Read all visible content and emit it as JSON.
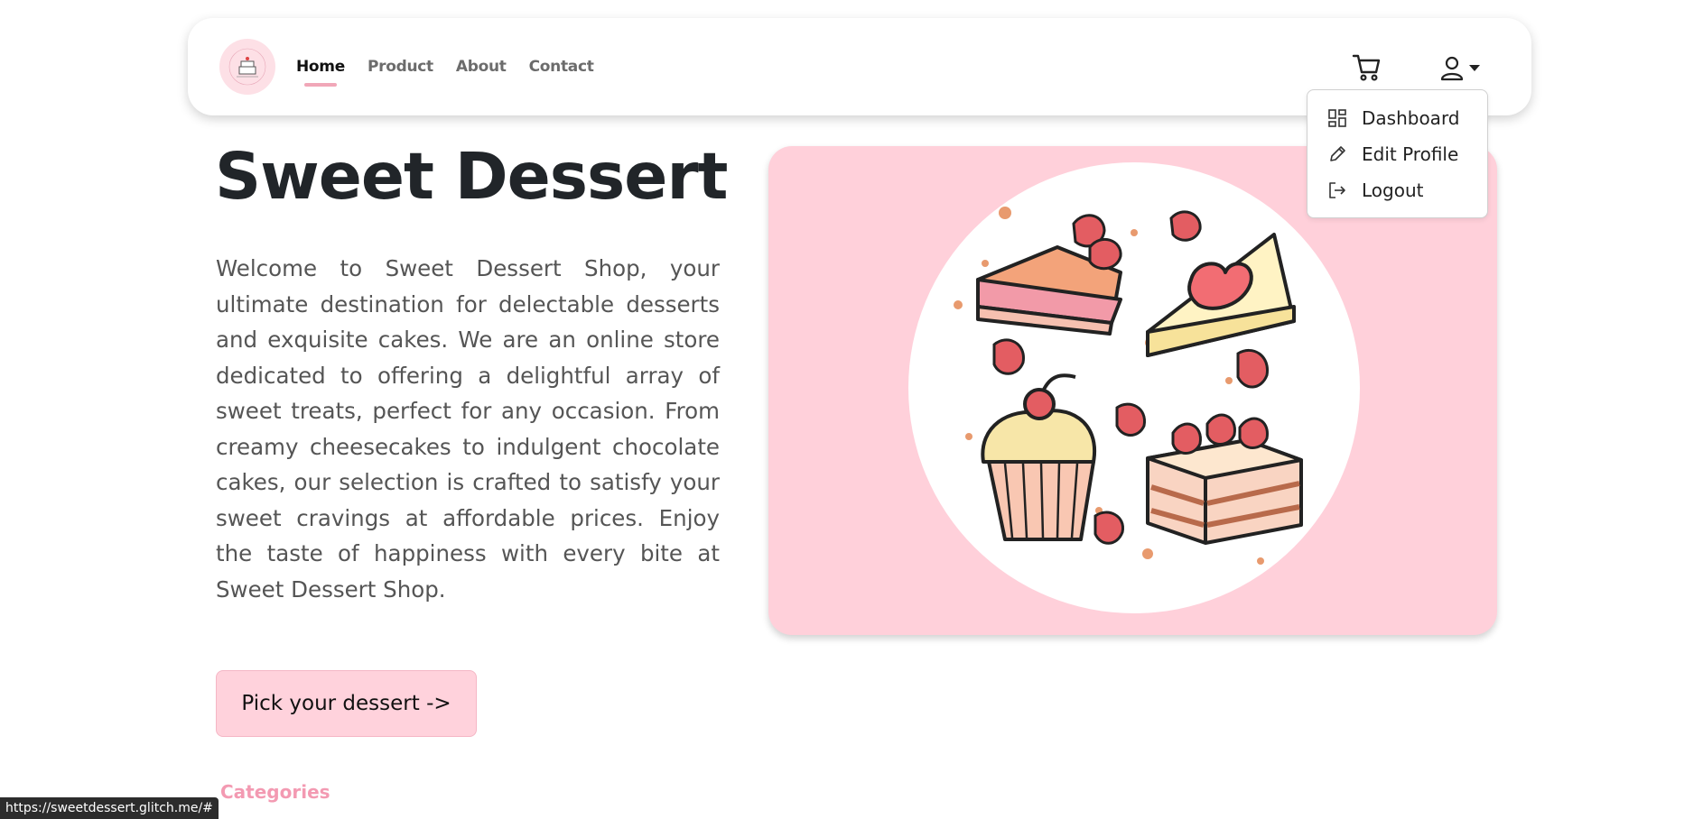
{
  "nav": {
    "links": [
      {
        "label": "Home",
        "active": true
      },
      {
        "label": "Product",
        "active": false
      },
      {
        "label": "About",
        "active": false
      },
      {
        "label": "Contact",
        "active": false
      }
    ]
  },
  "user_menu": {
    "items": [
      {
        "label": "Dashboard",
        "icon": "dashboard-icon"
      },
      {
        "label": "Edit Profile",
        "icon": "pencil-icon"
      },
      {
        "label": "Logout",
        "icon": "logout-icon"
      }
    ]
  },
  "hero": {
    "title": "Sweet Dessert",
    "description": "Welcome to Sweet Dessert Shop, your ultimate destination for delectable desserts and exquisite cakes. We are an online store dedicated to offering a delightful array of sweet treats, perfect for any occasion. From creamy cheesecakes to indulgent chocolate cakes, our selection is crafted to satisfy your sweet cravings at affordable prices. Enjoy the taste of happiness with every bite at Sweet Dessert Shop.",
    "cta_label": "Pick your dessert ->"
  },
  "sections": {
    "categories_heading": "Categories"
  },
  "status_bar": {
    "url": "https://sweetdessert.glitch.me/#"
  },
  "colors": {
    "accent_pink": "#f39ab2",
    "hero_bg": "#ffd0da",
    "button_bg": "#ffd2dc"
  }
}
